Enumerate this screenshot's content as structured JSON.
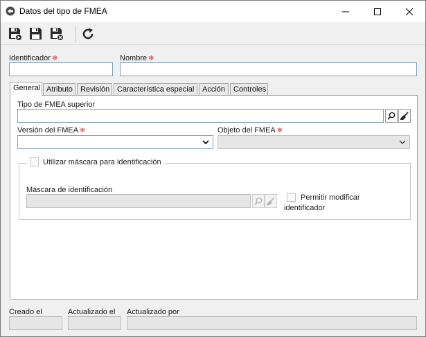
{
  "window": {
    "title": "Datos del tipo de FMEA"
  },
  "form": {
    "identificador_label": "Identificador",
    "identificador_value": "",
    "nombre_label": "Nombre",
    "nombre_value": ""
  },
  "tabs": [
    {
      "label": "General",
      "active": true
    },
    {
      "label": "Atributo",
      "active": false
    },
    {
      "label": "Revisión",
      "active": false
    },
    {
      "label": "Característica especial",
      "active": false
    },
    {
      "label": "Acción",
      "active": false
    },
    {
      "label": "Controles",
      "active": false
    }
  ],
  "general": {
    "tipo_superior_label": "Tipo de FMEA superior",
    "tipo_superior_value": "",
    "version_label": "Versión del FMEA",
    "version_value": "",
    "objeto_label": "Objeto del FMEA",
    "objeto_value": "",
    "mask_checkbox_label": "Utilizar máscara para identificación",
    "mask_label": "Máscara de identificación",
    "mask_value": "",
    "permitir_line1": "Permitir modificar",
    "permitir_line2": "identificador"
  },
  "footer": {
    "creado_label": "Creado el",
    "actualizado_el_label": "Actualizado el",
    "actualizado_por_label": "Actualizado por"
  },
  "colors": {
    "required": "#d9342b",
    "border": "#7f9db9",
    "disabled_bg": "#e6e6e6"
  }
}
